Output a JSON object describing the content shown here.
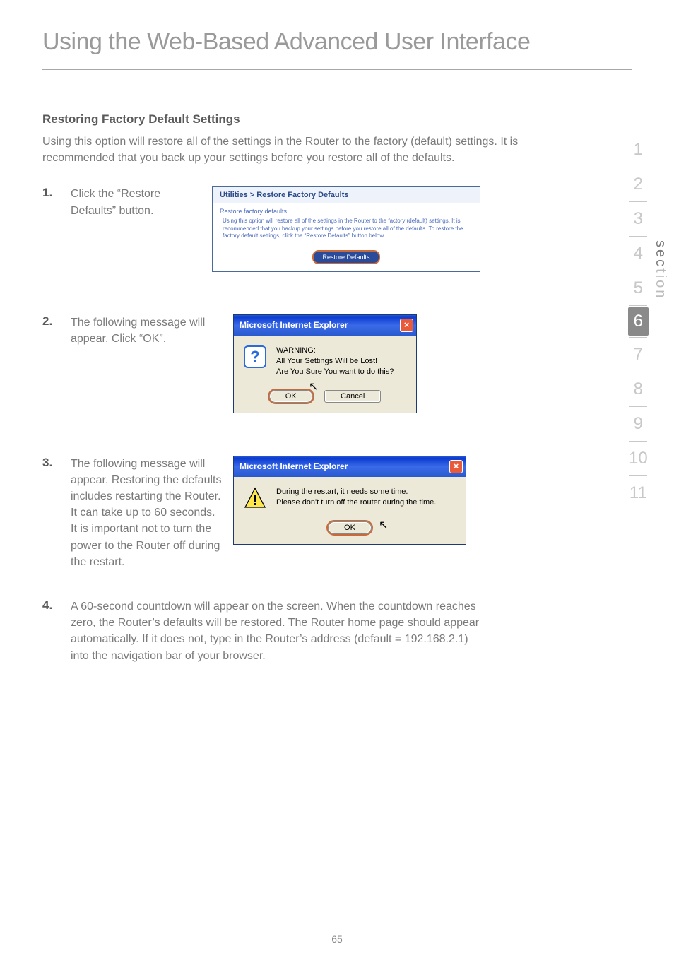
{
  "page_title": "Using the Web-Based Advanced User Interface",
  "heading": "Restoring Factory Default Settings",
  "intro": "Using this option will restore all of the settings in the Router to the factory (default) settings. It is recommended that you back up your settings before you restore all of the defaults.",
  "steps": {
    "s1_num": "1.",
    "s1_text": "Click the “Restore Defaults” button.",
    "s2_num": "2.",
    "s2_text": "The following message will appear. Click “OK”.",
    "s3_num": "3.",
    "s3_text": "The following message will appear. Restoring the defaults includes restarting the Router. It can take up to 60 seconds. It is important not to turn the power to the Router off during the restart.",
    "s4_num": "4.",
    "s4_text": "A 60-second countdown will appear on the screen. When the countdown reaches zero, the Router’s defaults will be restored. The Router home page should appear automatically. If it does not, type in the Router’s address (default = 192.168.2.1) into the navigation bar of your browser."
  },
  "panel1": {
    "breadcrumb": "Utilities > Restore Factory Defaults",
    "subhead": "Restore factory defaults",
    "desc": "Using this option will restore all of the settings in the Router to the factory (default) settings. It is recommended that you backup your settings before you restore all of the defaults. To restore the factory default settings, click the “Restore Defaults” button below.",
    "button": "Restore Defaults"
  },
  "dialog2": {
    "title": "Microsoft Internet Explorer",
    "line1": "WARNING:",
    "line2": "All Your Settings Will be Lost!",
    "line3": "Are You Sure You want to do this?",
    "ok": "OK",
    "cancel": "Cancel"
  },
  "dialog3": {
    "title": "Microsoft Internet Explorer",
    "line1": "During the restart, it needs some time.",
    "line2": "Please don't turn off the router during the time.",
    "ok": "OK"
  },
  "nav": {
    "n1": "1",
    "n2": "2",
    "n3": "3",
    "n4": "4",
    "n5": "5",
    "n6": "6",
    "n7": "7",
    "n8": "8",
    "n9": "9",
    "n10": "10",
    "n11": "11"
  },
  "section_word_1": "sec",
  "section_word_2": "tion",
  "page_number": "65"
}
